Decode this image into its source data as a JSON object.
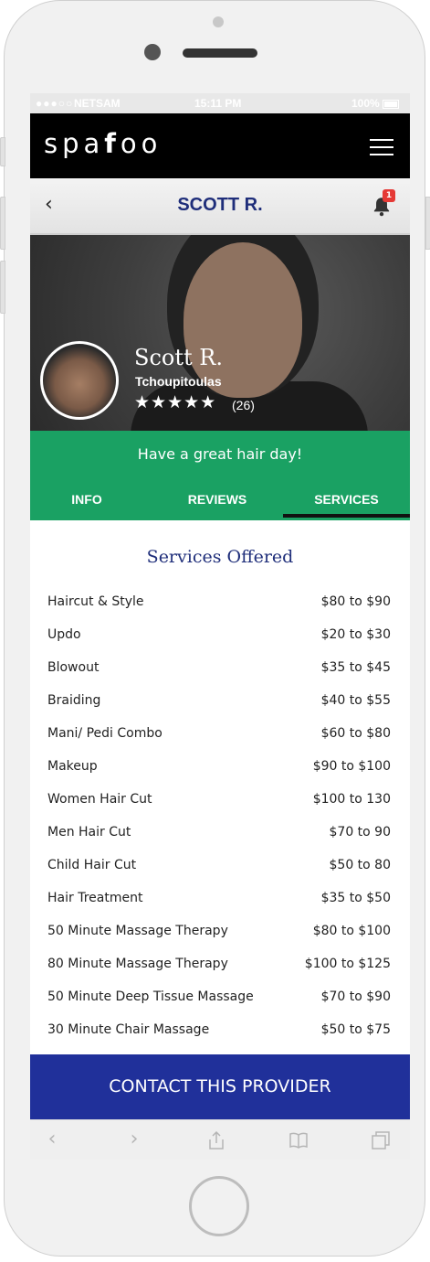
{
  "status_bar": {
    "signal": "●●●○○",
    "carrier": "NETSAM",
    "time": "15:11 PM",
    "battery": "100%"
  },
  "app": {
    "logo_light_1": "spa",
    "logo_bold": "f",
    "logo_light_2": "oo"
  },
  "nav": {
    "title": "SCOTT R.",
    "back_icon": "‹",
    "notification_count": "1"
  },
  "provider": {
    "name": "Scott R.",
    "location": "Tchoupitoulas",
    "stars": "★★★★★",
    "review_count": "(26)",
    "rating": 5
  },
  "tagline": "Have a great hair day!",
  "tabs": [
    {
      "label": "INFO"
    },
    {
      "label": "REVIEWS"
    },
    {
      "label": "SERVICES",
      "active": true
    }
  ],
  "services": {
    "title": "Services Offered",
    "items": [
      {
        "name": "Haircut & Style",
        "price": "$80 to $90"
      },
      {
        "name": "Updo",
        "price": "$20 to $30"
      },
      {
        "name": "Blowout",
        "price": "$35 to $45"
      },
      {
        "name": "Braiding",
        "price": "$40 to $55"
      },
      {
        "name": "Mani/ Pedi Combo",
        "price": "$60 to $80"
      },
      {
        "name": "Makeup",
        "price": "$90 to $100"
      },
      {
        "name": "Women Hair Cut",
        "price": "$100 to 130"
      },
      {
        "name": "Men Hair Cut",
        "price": "$70 to 90"
      },
      {
        "name": "Child Hair Cut",
        "price": "$50 to 80"
      },
      {
        "name": "Hair Treatment",
        "price": "$35 to $50"
      },
      {
        "name": "50 Minute Massage Therapy",
        "price": "$80 to $100"
      },
      {
        "name": "80 Minute Massage Therapy",
        "price": "$100 to $125"
      },
      {
        "name": "50 Minute Deep Tissue Massage",
        "price": "$70 to $90"
      },
      {
        "name": "30 Minute Chair Massage",
        "price": "$50 to $75"
      }
    ]
  },
  "contact_button": "CONTACT THIS PROVIDER",
  "safari": {
    "back_icon": "‹",
    "forward_icon": "›"
  },
  "colors": {
    "brand_navy": "#1f2e7a",
    "green": "#1aa163",
    "button_blue": "#20309a",
    "badge_red": "#e53935"
  }
}
